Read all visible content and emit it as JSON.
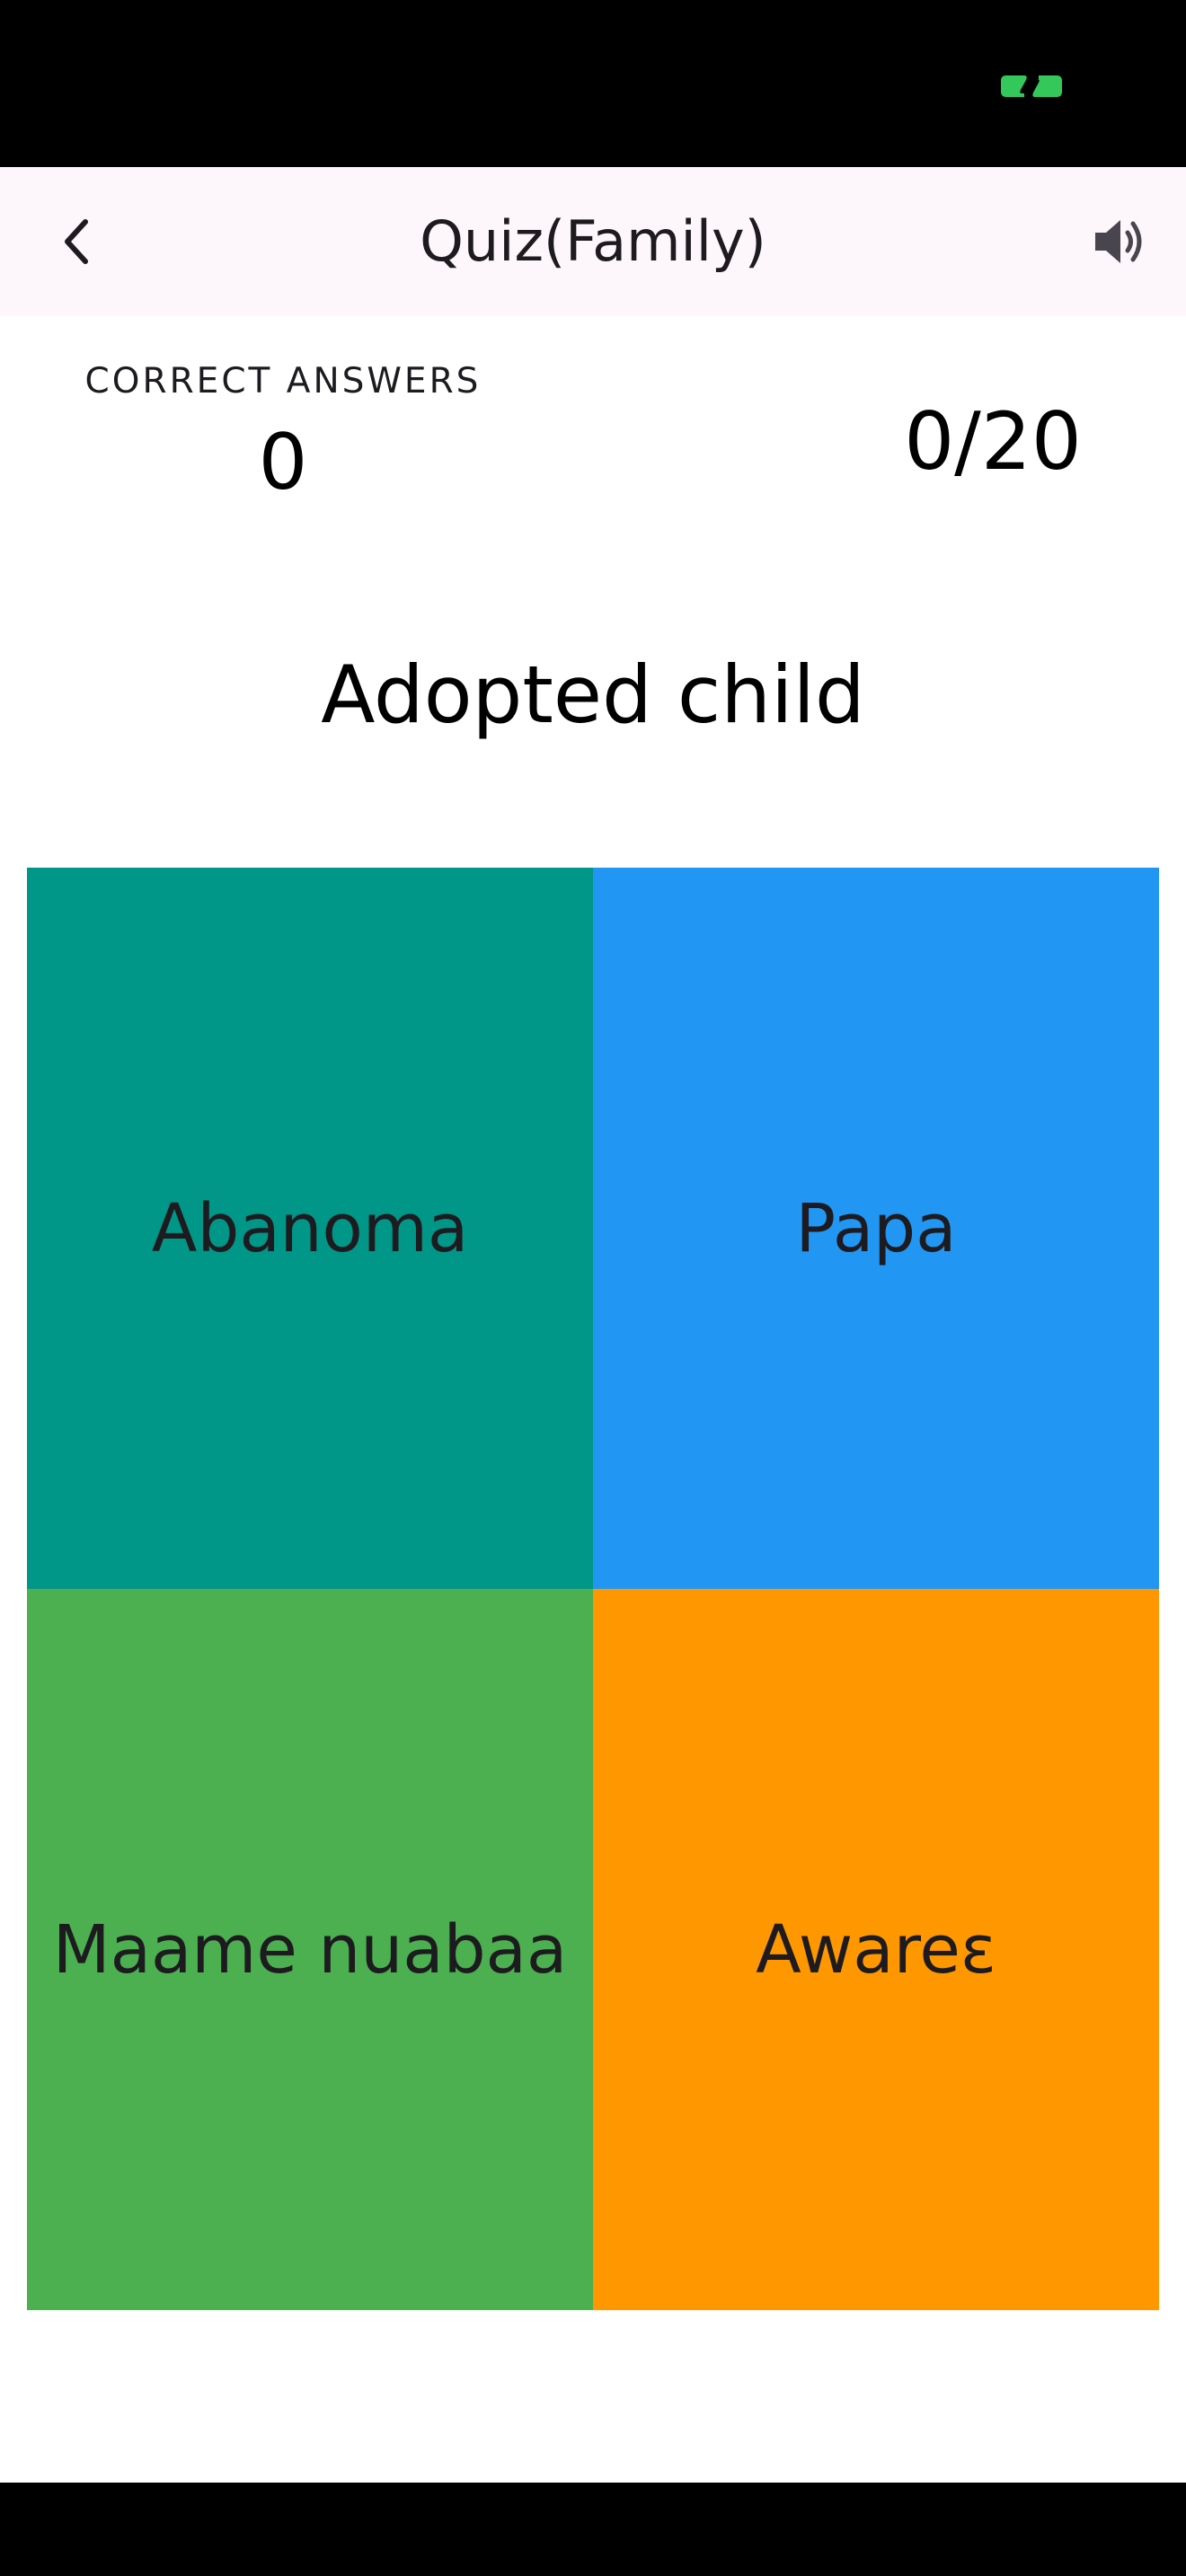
{
  "colors": {
    "status_bar": "#000000",
    "app_bar": "#fdf7fb",
    "indicator": "#34c759",
    "answer_1": "#009688",
    "answer_2": "#2196f3",
    "answer_3": "#4caf50",
    "answer_4": "#ff9800"
  },
  "app_bar": {
    "title": "Quiz(Family)",
    "back_icon": "chevron-left-icon",
    "sound_icon": "speaker-icon"
  },
  "score": {
    "correct_label": "CORRECT ANSWERS",
    "correct_value": "0",
    "progress": "0/20"
  },
  "question": "Adopted child",
  "answers": [
    {
      "label": "Abanoma"
    },
    {
      "label": "Papa"
    },
    {
      "label": "Maame nuabaa"
    },
    {
      "label": "Awareɛ"
    }
  ]
}
